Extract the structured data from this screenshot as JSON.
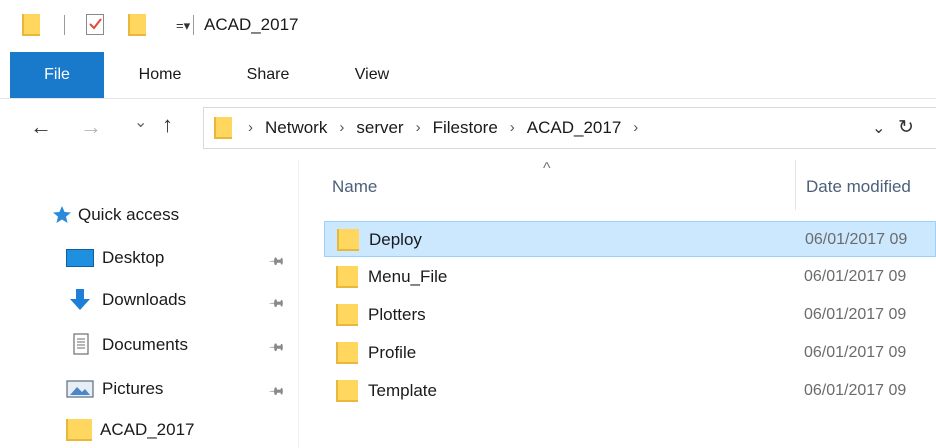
{
  "window": {
    "title": "ACAD_2017"
  },
  "quick_access": {
    "icons": [
      "folder-icon",
      "properties-check-icon",
      "new-folder-icon",
      "customize-dropdown-icon"
    ]
  },
  "ribbon": {
    "tabs": [
      {
        "label": "File",
        "active": true
      },
      {
        "label": "Home"
      },
      {
        "label": "Share"
      },
      {
        "label": "View"
      }
    ],
    "accent": "#1979CA"
  },
  "navigation": {
    "back": "←",
    "forward": "→",
    "recent": "⌄",
    "up": "↑",
    "breadcrumb": [
      "Network",
      "server",
      "Filestore",
      "ACAD_2017"
    ],
    "separator": "›",
    "dropdown": "⌄",
    "refresh": "↻"
  },
  "sidebar": {
    "quick_access_label": "Quick access",
    "items": [
      {
        "label": "Desktop",
        "pinned": true,
        "icon": "desktop-icon"
      },
      {
        "label": "Downloads",
        "pinned": true,
        "icon": "downloads-icon"
      },
      {
        "label": "Documents",
        "pinned": true,
        "icon": "documents-icon"
      },
      {
        "label": "Pictures",
        "pinned": true,
        "icon": "pictures-icon"
      },
      {
        "label": "ACAD_2017",
        "pinned": false,
        "icon": "folder-icon"
      }
    ]
  },
  "file_list": {
    "columns": [
      "Name",
      "Date modified"
    ],
    "sort_indicator": "^",
    "rows": [
      {
        "name": "Deploy",
        "date": "06/01/2017 09",
        "selected": true
      },
      {
        "name": "Menu_File",
        "date": "06/01/2017 09"
      },
      {
        "name": "Plotters",
        "date": "06/01/2017 09"
      },
      {
        "name": "Profile",
        "date": "06/01/2017 09"
      },
      {
        "name": "Template",
        "date": "06/01/2017 09"
      }
    ],
    "selection_color": "#CCE8FF"
  }
}
